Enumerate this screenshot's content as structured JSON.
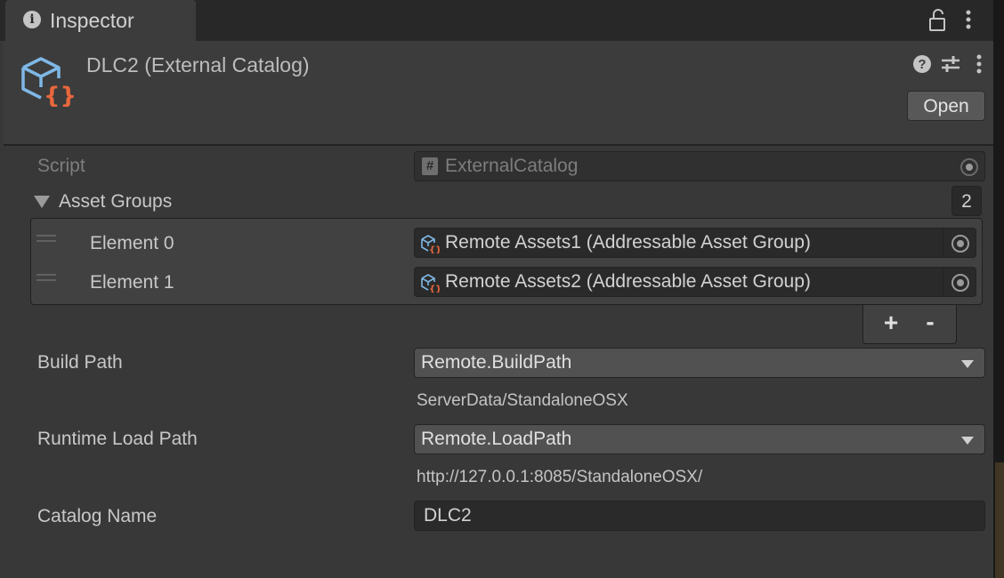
{
  "window": {
    "tab_title": "Inspector"
  },
  "asset": {
    "title": "DLC2 (External Catalog)",
    "open_label": "Open"
  },
  "script": {
    "label": "Script",
    "value": "ExternalCatalog"
  },
  "asset_groups": {
    "label": "Asset Groups",
    "count": "2",
    "elements": [
      {
        "label": "Element 0",
        "value": "Remote Assets1 (Addressable Asset Group)"
      },
      {
        "label": "Element 1",
        "value": "Remote Assets2 (Addressable Asset Group)"
      }
    ],
    "add_label": "+",
    "remove_label": "-"
  },
  "build_path": {
    "label": "Build Path",
    "selected": "Remote.BuildPath",
    "resolved": "ServerData/StandaloneOSX"
  },
  "load_path": {
    "label": "Runtime Load Path",
    "selected": "Remote.LoadPath",
    "resolved": "http://127.0.0.1:8085/StandaloneOSX/"
  },
  "catalog_name": {
    "label": "Catalog Name",
    "value": "DLC2"
  },
  "colors": {
    "panel": "#383838",
    "header": "#3c3c3c",
    "field": "#2a2a2a",
    "cube": "#7fb8e6",
    "braces": "#e8673c"
  }
}
